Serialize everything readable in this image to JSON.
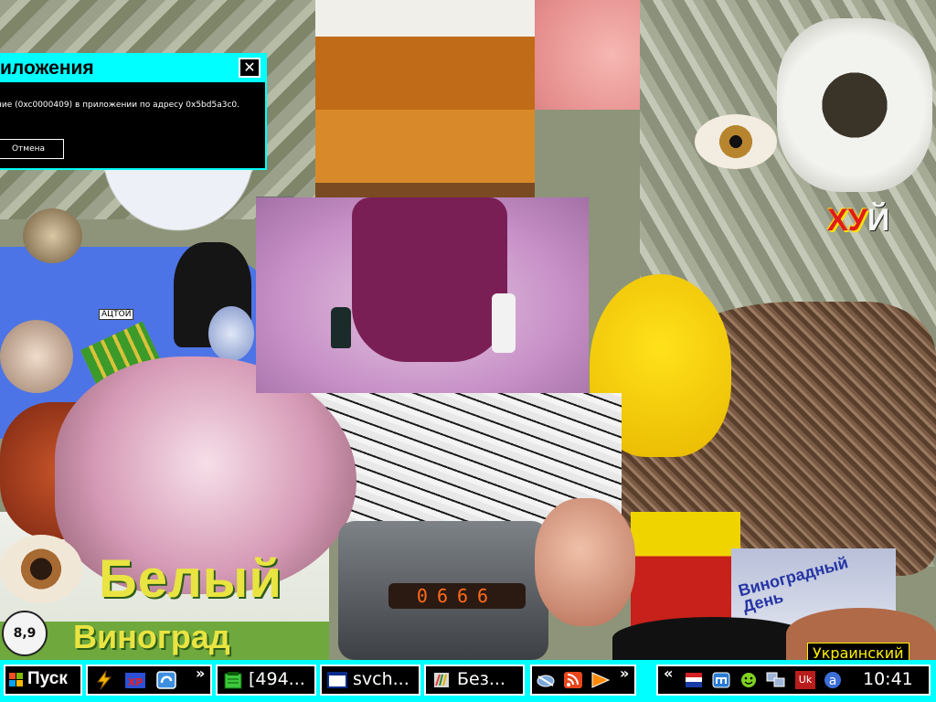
{
  "dialog": {
    "title": "иложения",
    "message": "ние (0xc0000409) в приложении по адресу 0x5bd5a3c0.",
    "cancel_label": "Отмена",
    "close_glyph": "✕"
  },
  "collage": {
    "sticker_xu": "ХУ",
    "sticker_y": "Й",
    "sticker_belyi": "Белый",
    "sticker_vino": "Виноград",
    "sticker_den": "Виноградный День",
    "sticker_aktoy": "АЦТОЙ",
    "sticker_89": "8,9",
    "nixie_display": "0666"
  },
  "taskbar": {
    "start_label": "Пуск",
    "quicklaunch_chevron": "»",
    "tasks": [
      {
        "label": "[494...",
        "icon": "notepad-icon"
      },
      {
        "label": "svch...",
        "icon": "window-icon"
      },
      {
        "label": "Без...",
        "icon": "paint-icon"
      }
    ],
    "tray_chevron": "»",
    "tray_collapse": "«",
    "language_code": "Uk",
    "clock": "10:41",
    "tooltip": "Украинский"
  },
  "colors": {
    "accent": "#00ffff",
    "tooltip_text": "#fff000",
    "dark": "#000000"
  }
}
